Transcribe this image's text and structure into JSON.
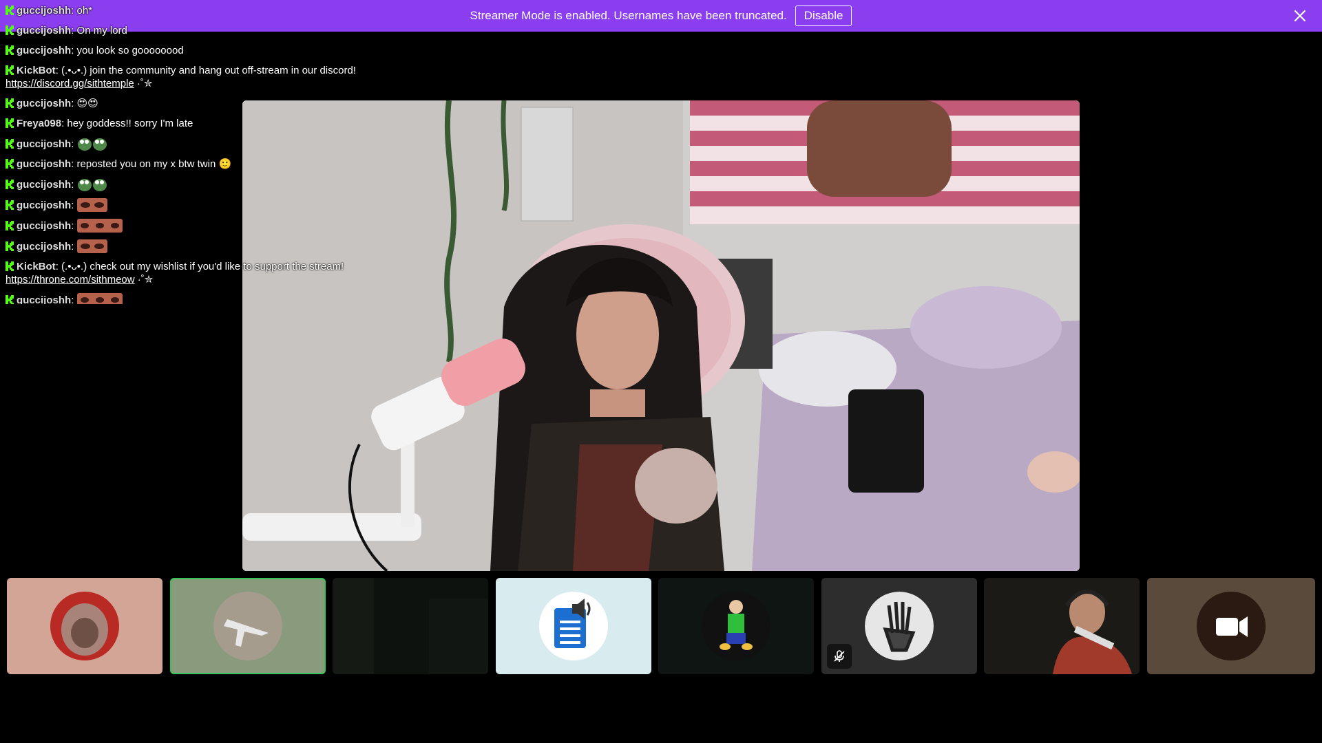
{
  "banner": {
    "message": "Streamer Mode is enabled. Usernames have been truncated.",
    "disable_label": "Disable"
  },
  "chat": {
    "messages": [
      {
        "user": "guccijoshh",
        "text": "oh*",
        "emotes": 0
      },
      {
        "user": "guccijoshh",
        "text": "On my lord",
        "emotes": 0
      },
      {
        "user": "guccijoshh",
        "text": "you look so goooooood",
        "emotes": 0
      },
      {
        "user": "KickBot",
        "text": "(.•ᴗ•.) join the community and hang out off-stream in our discord!",
        "link": "https://discord.gg/sithtemple",
        "suffix": " ·˚✮"
      },
      {
        "user": "guccijoshh",
        "text": "",
        "emoji": "😍😍"
      },
      {
        "user": "Freya098",
        "text": "hey goddess!! sorry I'm late"
      },
      {
        "user": "guccijoshh",
        "text": "",
        "emote_kind": "frog",
        "emotes": 2
      },
      {
        "user": "guccijoshh",
        "text": "reposted you on my x btw twin",
        "emoji": "🙂"
      },
      {
        "user": "guccijoshh",
        "text": "",
        "emote_kind": "frog",
        "emotes": 2
      },
      {
        "user": "guccijoshh",
        "text": "",
        "emote_kind": "eyes",
        "emotes": 1
      },
      {
        "user": "guccijoshh",
        "text": "",
        "emote_kind": "eyes",
        "emotes": 2
      },
      {
        "user": "guccijoshh",
        "text": "",
        "emote_kind": "eyes",
        "emotes": 1
      },
      {
        "user": "KickBot",
        "text": "(.•ᴗ•.) check out my wishlist if you'd like to support the stream!",
        "link": "https://throne.com/sithmeow",
        "suffix": " ·˚✮"
      },
      {
        "user": "guccijoshh",
        "text": "",
        "emote_kind": "eyes",
        "emotes": 2
      }
    ]
  },
  "colors": {
    "banner_bg": "#8b3ef0",
    "kick_green": "#53fc18",
    "active_tile_border": "#36c35a"
  },
  "tiles": [
    {
      "name": "participant-1",
      "bg": "#d3a597",
      "icon": "hooded-avatar"
    },
    {
      "name": "participant-2",
      "bg": "#8a9a7c",
      "icon": "plane-avatar",
      "active": true
    },
    {
      "name": "participant-3",
      "bg": "#0d0f0c",
      "icon": "dark-camera-feed"
    },
    {
      "name": "participant-4",
      "bg": "#d8ecf0",
      "icon": "document-speaker-icon"
    },
    {
      "name": "participant-5",
      "bg": "#0f1512",
      "icon": "green-character-avatar"
    },
    {
      "name": "participant-6",
      "bg": "#2d2d2d",
      "icon": "mechanical-hand-avatar",
      "muted": true
    },
    {
      "name": "participant-7",
      "bg": "#1a1815",
      "icon": "headset-man-camera-feed"
    },
    {
      "name": "participant-8",
      "bg": "#5a4a3c",
      "icon": "video-camera-icon"
    }
  ]
}
